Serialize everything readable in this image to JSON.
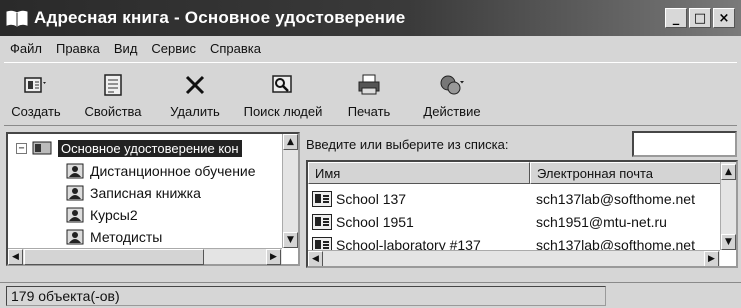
{
  "window": {
    "title": "Адресная книга - Основное удостоверение",
    "buttons": {
      "minimize": "_",
      "maximize": "□",
      "close": "×"
    }
  },
  "menu": [
    "Файл",
    "Правка",
    "Вид",
    "Сервис",
    "Справка"
  ],
  "toolbar": [
    {
      "label": "Создать",
      "icon": "new-contact-icon"
    },
    {
      "label": "Свойства",
      "icon": "properties-icon"
    },
    {
      "label": "Удалить",
      "icon": "delete-icon"
    },
    {
      "label": "Поиск людей",
      "icon": "find-people-icon"
    },
    {
      "label": "Печать",
      "icon": "print-icon"
    },
    {
      "label": "Действие",
      "icon": "action-icon"
    }
  ],
  "tree": {
    "root": "Основное удостоверение кон",
    "root_expander": "−",
    "children": [
      "Дистанционное обучение",
      "Записная книжка",
      "Курсы2",
      "Методисты"
    ]
  },
  "search": {
    "label": "Введите или выберите из списка:",
    "value": ""
  },
  "list": {
    "columns": [
      "Имя",
      "Электронная почта"
    ],
    "rows": [
      {
        "name": "School 137",
        "email": "sch137lab@softhome.net"
      },
      {
        "name": "School 1951",
        "email": "sch1951@mtu-net.ru"
      },
      {
        "name": "School-laboratory #137",
        "email": "sch137lab@softhome.net"
      }
    ]
  },
  "status": {
    "text": "179 объекта(-ов)"
  }
}
